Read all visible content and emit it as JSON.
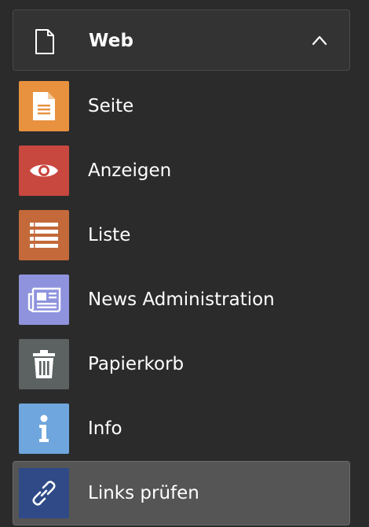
{
  "group": {
    "title": "Web",
    "icon": "document-icon",
    "expanded": true
  },
  "items": [
    {
      "label": "Seite",
      "icon": "page-icon",
      "color": "#e8913e"
    },
    {
      "label": "Anzeigen",
      "icon": "eye-icon",
      "color": "#c8473f"
    },
    {
      "label": "Liste",
      "icon": "list-icon",
      "color": "#c3693a"
    },
    {
      "label": "News Administration",
      "icon": "newspaper-icon",
      "color": "#8f93dd"
    },
    {
      "label": "Papierkorb",
      "icon": "trash-icon",
      "color": "#5c6262"
    },
    {
      "label": "Info",
      "icon": "info-icon",
      "color": "#6ea6dd"
    },
    {
      "label": "Links prüfen",
      "icon": "link-icon",
      "color": "#2f4a86",
      "active": true
    }
  ]
}
